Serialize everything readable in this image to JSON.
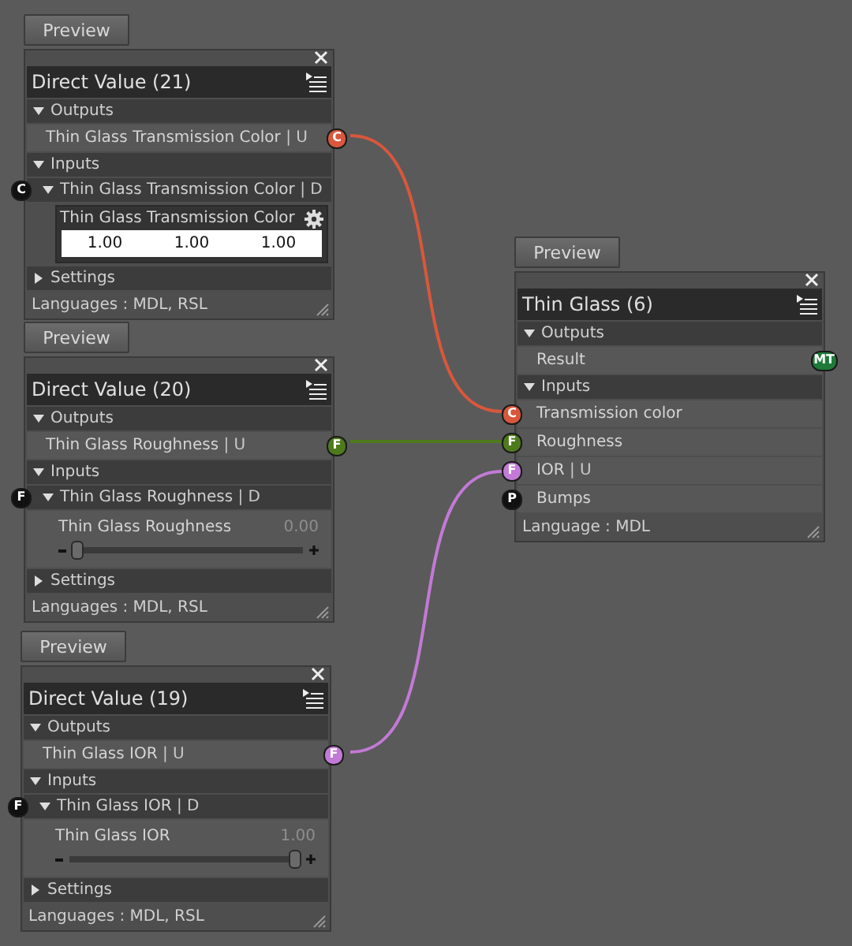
{
  "nodes": [
    {
      "preview": "Preview",
      "title": "Direct Value (21)",
      "outputs_label": "Outputs",
      "outputs": [
        {
          "label": "Thin Glass Transmission Color",
          "suffix": "| U",
          "socket": "C",
          "color": "#d9573c"
        }
      ],
      "inputs_label": "Inputs",
      "inputs": [
        {
          "kind": "group",
          "label": "Thin Glass Transmission Color",
          "suffix": "| D",
          "socket": "C",
          "color": "#111111",
          "expanded": true,
          "editor": {
            "kind": "color",
            "label": "Thin Glass Transmission Color",
            "values": [
              "1.00",
              "1.00",
              "1.00"
            ]
          }
        }
      ],
      "settings": {
        "label": "Settings",
        "expanded": false
      },
      "footer": "Languages : MDL, RSL"
    },
    {
      "preview": "Preview",
      "title": "Direct Value (20)",
      "outputs_label": "Outputs",
      "outputs": [
        {
          "label": "Thin Glass Roughness",
          "suffix": "| U",
          "socket": "F",
          "color": "#4f7a1c"
        }
      ],
      "inputs_label": "Inputs",
      "inputs": [
        {
          "kind": "group",
          "label": "Thin Glass Roughness",
          "suffix": "| D",
          "socket": "F",
          "color": "#111111",
          "expanded": true,
          "editor": {
            "kind": "slider",
            "label": "Thin Glass Roughness",
            "reading": "0.00",
            "level": 0
          }
        }
      ],
      "settings": {
        "label": "Settings",
        "expanded": false
      },
      "footer": "Languages : MDL, RSL"
    },
    {
      "preview": "Preview",
      "title": "Direct Value (19)",
      "outputs_label": "Outputs",
      "outputs": [
        {
          "label": "Thin Glass IOR",
          "suffix": "| U",
          "socket": "F",
          "color": "#c27ad6"
        }
      ],
      "inputs_label": "Inputs",
      "inputs": [
        {
          "kind": "group",
          "label": "Thin Glass IOR",
          "suffix": "| D",
          "socket": "F",
          "color": "#111111",
          "expanded": true,
          "editor": {
            "kind": "slider",
            "label": "Thin Glass IOR",
            "reading": "1.00",
            "level": 1
          }
        }
      ],
      "settings": {
        "label": "Settings",
        "expanded": false
      },
      "footer": "Languages : MDL, RSL"
    },
    {
      "preview": "Preview",
      "title": "Thin Glass (6)",
      "outputs_label": "Outputs",
      "outputs": [
        {
          "label": "Result",
          "socket": "MT",
          "color": "#1f7a3a"
        }
      ],
      "inputs_label": "Inputs",
      "inputs": [
        {
          "kind": "plain",
          "label": "Transmission color",
          "socket": "C",
          "color": "#d9573c"
        },
        {
          "kind": "plain",
          "label": "Roughness",
          "socket": "F",
          "color": "#4f7a1c"
        },
        {
          "kind": "plain",
          "label": "IOR",
          "suffix": "| U",
          "socket": "F",
          "color": "#c27ad6"
        },
        {
          "kind": "plain",
          "label": "Bumps",
          "socket": "P",
          "color": "#111111"
        }
      ],
      "footer": "Language : MDL"
    }
  ]
}
